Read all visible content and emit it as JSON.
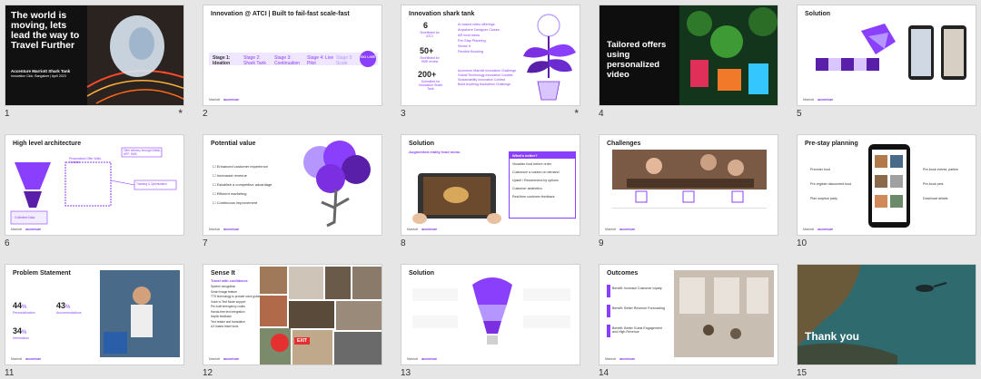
{
  "slides": [
    {
      "number": "1",
      "starred": "*",
      "title_lines": [
        "The world is",
        "moving, lets",
        "lead the way to",
        "Travel Further"
      ],
      "subtitle": "Accenture Marriott Shark Tank",
      "subline": "Innovation Club, Bangalore | April 2023"
    },
    {
      "number": "2",
      "title": "Innovation @ ATCI | Built to fail-fast scale-fast",
      "stages": [
        "Stage 1: Ideation",
        "Stage 2: Shark Tank",
        "Stage 3: Continuation",
        "Stage 4: Live Pilot",
        "Stage 5: Scale"
      ],
      "go_live": "GO LIVE"
    },
    {
      "number": "3",
      "starred": "*",
      "title": "Innovation shark tank",
      "stats": [
        {
          "value": "6",
          "label": "Shortlisted for ATCI"
        },
        {
          "value": "50+",
          "label": "Shortlisted for SME review"
        },
        {
          "value": "200+",
          "label": "Submitted for Innovation Shark Tank"
        }
      ],
      "items": [
        "AI based video offerings",
        "Anywhere Designer Closes",
        "AR food menu",
        "Pre-Stay Planning",
        "Sense It",
        "Flexible Booking"
      ],
      "more_items": [
        "Accenture Marriott Innovation Challenge",
        "Global Technology Innovation Contest",
        "Sustainability Innovation Contest",
        "Build Anything Hackathon Challenge"
      ]
    },
    {
      "number": "4",
      "title_lines": [
        "Tailored offers",
        "using",
        "personalized",
        "video"
      ]
    },
    {
      "number": "5",
      "title": "Solution"
    },
    {
      "number": "6",
      "title": "High level architecture",
      "labels": [
        "Offer delivery through EMAIL, APP, SMS",
        "Personalized Offer Video Creation",
        "Collected Data",
        "Tracking & Optimization"
      ]
    },
    {
      "number": "7",
      "title": "Potential value",
      "items": [
        "Enhanced customer experience",
        "Increased revenue",
        "Establish a competitive advantage",
        "Efficient marketing",
        "Continuous improvement"
      ]
    },
    {
      "number": "8",
      "title": "Solution",
      "subtitle": "Augmented reality food menu",
      "panel_title": "What's better?",
      "items": [
        "Visualize food before order",
        "Customize a custom on demand",
        "Upsell / Recommend by options",
        "Customer aesthetics",
        "Real time customer feedback"
      ]
    },
    {
      "number": "9",
      "title": "Challenges"
    },
    {
      "number": "10",
      "title": "Pre-stay planning",
      "left_items": [
        "Preorder food",
        "Pre-register discounted food",
        "Plan surprise party"
      ],
      "right_items": [
        "Pre-book events, parties",
        "Pre-book pets",
        "Download details"
      ]
    },
    {
      "number": "11",
      "title": "Problem Statement",
      "stats": [
        {
          "value": "44",
          "unit": "%",
          "label": "Personalization"
        },
        {
          "value": "43",
          "unit": "%",
          "label": "Accommodations"
        },
        {
          "value": "34",
          "unit": "%",
          "label": "Information"
        }
      ]
    },
    {
      "number": "12",
      "title": "Sense It",
      "subtitle": "Travel with confidence",
      "items": [
        "Speech recognition",
        "Smart Image feature",
        "TTS technology to provide voice guided instructions",
        "Voice to Text Mode support",
        "Pre-built emergency codes",
        "Hands-free text integration",
        "Haptic feedback",
        "Text reader and translation",
        "UX based travel tools"
      ],
      "sign": "EXIT"
    },
    {
      "number": "13",
      "title": "Solution"
    },
    {
      "number": "14",
      "title": "Outcomes",
      "items": [
        "Benefit: Increase Customer loyalty",
        "Benefit: Better Revenue Forecasting",
        "Benefit: Better Guest Engagement and High Revenue"
      ]
    },
    {
      "number": "15",
      "title": "Thank you"
    }
  ],
  "footer": {
    "left": "Marriott",
    "right": "accenture"
  },
  "colors": {
    "accent": "#8a3ffc",
    "accent_light": "#e9dcff",
    "dark": "#1a1a1a"
  }
}
